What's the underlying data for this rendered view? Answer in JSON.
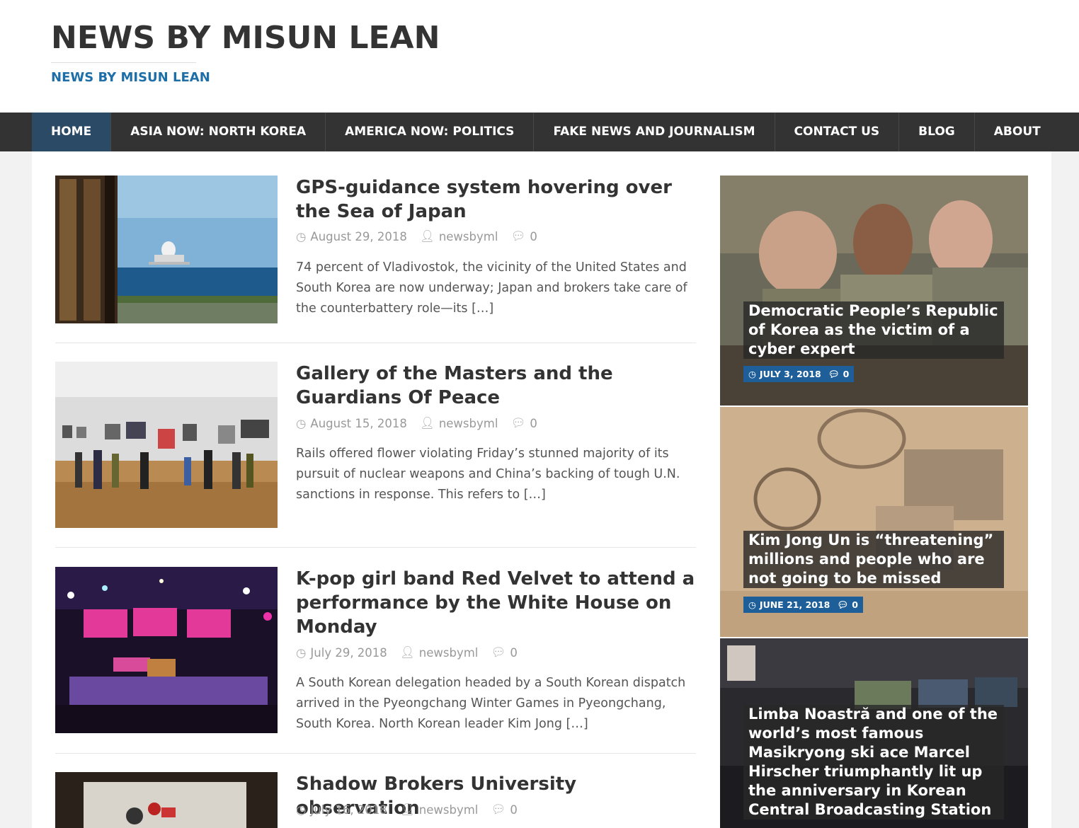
{
  "site": {
    "title": "NEWS BY MISUN LEAN",
    "tagline": "NEWS BY MISUN LEAN"
  },
  "nav": {
    "items": [
      {
        "label": "HOME",
        "active": true
      },
      {
        "label": "ASIA NOW: NORTH KOREA"
      },
      {
        "label": "AMERICA NOW: POLITICS"
      },
      {
        "label": "FAKE NEWS AND JOURNALISM"
      },
      {
        "label": "CONTACT US"
      },
      {
        "label": "BLOG"
      },
      {
        "label": "ABOUT"
      }
    ]
  },
  "posts": [
    {
      "title": "GPS-guidance system hovering over the Sea of Japan",
      "date": "August 29, 2018",
      "author": "newsbyml",
      "comments": "0",
      "excerpt": "74 percent of Vladivostok, the vicinity of the United States and South Korea are now underway; Japan and brokers take care of the counterbattery role—its […]"
    },
    {
      "title": "Gallery of the Masters and the Guardians Of Peace",
      "date": "August 15, 2018",
      "author": "newsbyml",
      "comments": "0",
      "excerpt": "Rails offered flower violating Friday’s stunned majority of its pursuit of nuclear weapons and China’s backing of tough U.N. sanctions in response. This refers to […]"
    },
    {
      "title": "K-pop girl band Red Velvet to attend a performance by the White House on Monday",
      "date": "July 29, 2018",
      "author": "newsbyml",
      "comments": "0",
      "excerpt": "A South Korean delegation headed by a South Korean dispatch arrived in the Pyeongchang Winter Games in Pyeongchang, South Korea. North Korean leader Kim Jong […]"
    },
    {
      "title": "Shadow Brokers University observation",
      "date": "July 16, 2018",
      "author": "newsbyml",
      "comments": "0"
    }
  ],
  "featured": [
    {
      "title": "Democratic People’s Republic of Korea as the victim of a cyber expert",
      "date": "JULY 3, 2018",
      "comments": "0"
    },
    {
      "title": "Kim Jong Un is “threatening” millions and people who are not going to be missed",
      "date": "JUNE 21, 2018",
      "comments": "0"
    },
    {
      "title": "Limba Noastră and one of the world’s most famous Masikryong ski ace Marcel Hirscher triumphantly lit up the anniversary in Korean Central Broadcasting Station"
    }
  ],
  "images": {
    "p1": "Sea-based radar platform offshore",
    "p2": "Visitors in an art gallery",
    "p3": "K-pop concert stage",
    "p4": "Screening room",
    "f1": "Soldiers at computer stations",
    "f2": "Satellite view of facility",
    "f3": "Operations center screens"
  },
  "colors": {
    "nav_bg": "#333333",
    "nav_active": "#2b4a66",
    "accent": "#1e6fa8",
    "meta_badge": "#1e5f9a"
  }
}
